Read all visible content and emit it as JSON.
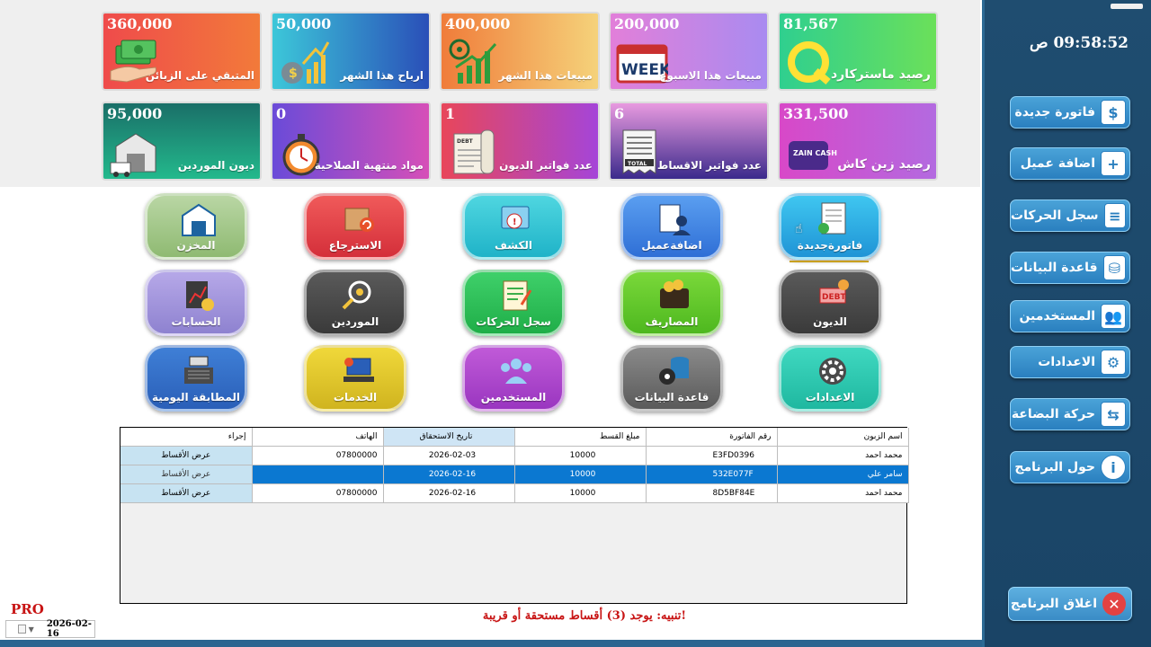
{
  "clock": "09:58:52 ص",
  "sidebar": {
    "buttons": [
      {
        "label": "فاتورة جديدة",
        "icon": "invoice-icon",
        "glyph": "$"
      },
      {
        "label": "اضافة عميل",
        "icon": "add-user-icon",
        "glyph": "+"
      },
      {
        "label": "سجل الحركات",
        "icon": "log-icon",
        "glyph": "≡"
      },
      {
        "label": "قاعدة البيانات",
        "icon": "database-icon",
        "glyph": "⛁"
      },
      {
        "label": "المستخدمين",
        "icon": "users-icon",
        "glyph": "👥"
      },
      {
        "label": "الاعدادات",
        "icon": "gear-icon",
        "glyph": "⚙"
      },
      {
        "label": "حركة البضاعة",
        "icon": "goods-icon",
        "glyph": "⇆"
      },
      {
        "label": "حول البرنامج",
        "icon": "info-icon",
        "glyph": "i"
      }
    ],
    "exit_label": "اغلاق البرنامج",
    "exit_glyph": "✕"
  },
  "cards": [
    {
      "value": "360,000",
      "title": "المتبقي على الزبائن",
      "icon": "money-hand-icon"
    },
    {
      "value": "50,000",
      "title": "ارباح هذا الشهر",
      "icon": "profit-chart-icon"
    },
    {
      "value": "400,000",
      "title": "مبيعات هذا الشهر",
      "icon": "sales-chart-icon"
    },
    {
      "value": "200,000",
      "title": "مبيعات هذا الاسبوع",
      "icon": "week-calendar-icon",
      "badge": "WEEK"
    },
    {
      "value": "81,567",
      "title": "رصيد ماستركارد",
      "icon": "mastercard-icon"
    },
    {
      "value": "95,000",
      "title": "ديون الموردين",
      "icon": "warehouse-truck-icon"
    },
    {
      "value": "0",
      "title": "مواد منتهية الصلاحية",
      "icon": "stopwatch-icon"
    },
    {
      "value": "1",
      "title": "عدد فواتير الديون",
      "icon": "debt-receipt-icon",
      "badge": "DEBT"
    },
    {
      "value": "6",
      "title": "عدد فواتير الاقساط",
      "icon": "receipt-icon",
      "badge": "TOTAL"
    },
    {
      "value": "331,500",
      "title": "رصيد زين كاش",
      "icon": "zaincash-icon",
      "badge": "ZAIN CASH"
    }
  ],
  "main_buttons": [
    {
      "label": "المخزن",
      "icon": "warehouse-icon"
    },
    {
      "label": "الاسترجاع",
      "icon": "return-box-icon"
    },
    {
      "label": "الكشف",
      "icon": "statement-icon"
    },
    {
      "label": "اضافةعميل",
      "icon": "add-customer-icon"
    },
    {
      "label": "فاتورةجديدة",
      "icon": "new-invoice-icon"
    },
    {
      "label": "الحسابات",
      "icon": "accounts-icon"
    },
    {
      "label": "الموردين",
      "icon": "suppliers-icon"
    },
    {
      "label": "سجل الحركات",
      "icon": "movement-log-icon"
    },
    {
      "label": "المصاريف",
      "icon": "wallet-icon"
    },
    {
      "label": "الديون",
      "icon": "debts-icon",
      "badge": "DEBT"
    },
    {
      "label": "المطابقة اليومية",
      "icon": "cash-register-icon"
    },
    {
      "label": "الخدمات",
      "icon": "services-icon"
    },
    {
      "label": "المستخدمين",
      "icon": "users-group-icon"
    },
    {
      "label": "قاعدة البيانات",
      "icon": "database-gear-icon"
    },
    {
      "label": "الاعدادات",
      "icon": "settings-gear-icon"
    }
  ],
  "table": {
    "headers": [
      "اسم الزبون",
      "رقم الفاتورة",
      "مبلغ القسط",
      "تاريخ الاستحقاق",
      "الهاتف",
      "إجراء"
    ],
    "rows": [
      {
        "name": "محمد احمد",
        "invoice": "E3FD0396",
        "amount": "10000",
        "due": "2026-02-03",
        "phone": "07800000",
        "action": "عرض الأقساط"
      },
      {
        "name": "سامر علي",
        "invoice": "532E077F",
        "amount": "10000",
        "due": "2026-02-16",
        "phone": "",
        "action": "عرض الأقساط"
      },
      {
        "name": "محمد احمد",
        "invoice": "8D5BF84E",
        "amount": "10000",
        "due": "2026-02-16",
        "phone": "07800000",
        "action": "عرض الأقساط"
      }
    ]
  },
  "alert": "!تنبيه: يوجد (3) أقساط مستحقة أو قريبة",
  "pro_label": "PRO",
  "date_field": "2026-02-16",
  "colors": {
    "sidebar_bg": "#1f4d70",
    "selected_row": "#0b78d1",
    "alert_text": "#c81414"
  }
}
